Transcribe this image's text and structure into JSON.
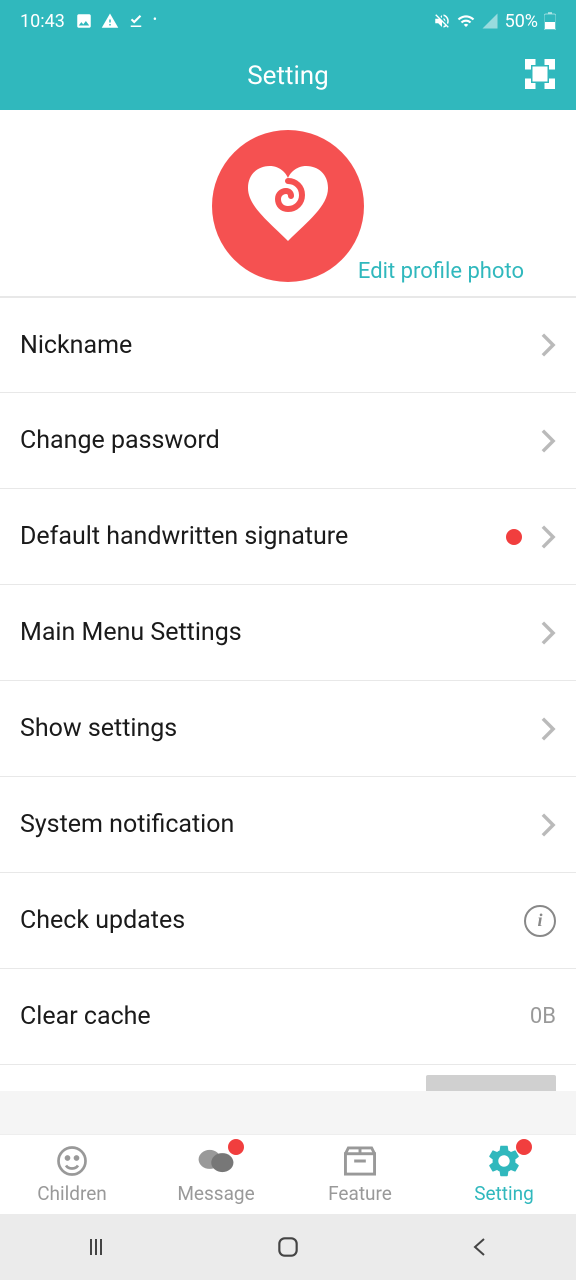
{
  "statusBar": {
    "time": "10:43",
    "battery": "50%"
  },
  "header": {
    "title": "Setting"
  },
  "profile": {
    "editPhotoLabel": "Edit profile photo"
  },
  "menu": {
    "nickname": "Nickname",
    "changePassword": "Change password",
    "defaultSignature": "Default handwritten signature",
    "mainMenuSettings": "Main Menu Settings",
    "showSettings": "Show settings",
    "systemNotification": "System notification",
    "checkUpdates": "Check updates",
    "clearCache": "Clear cache",
    "clearCacheValue": "0B"
  },
  "bottomNav": {
    "children": "Children",
    "message": "Message",
    "feature": "Feature",
    "setting": "Setting"
  }
}
